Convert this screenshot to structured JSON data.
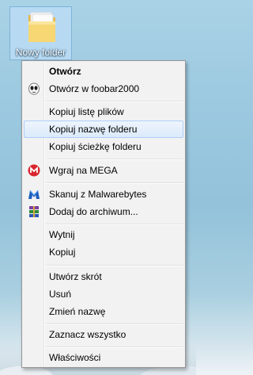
{
  "desktop": {
    "selected_item_label": "Nowy folder",
    "icon": "folder-icon"
  },
  "menu": {
    "items": [
      {
        "label": "Otwórz",
        "bold": true
      },
      {
        "label": "Otwórz w foobar2000",
        "icon": "foobar2000-icon"
      },
      {
        "label": "Kopiuj listę plików"
      },
      {
        "label": "Kopiuj nazwę folderu",
        "highlighted": true
      },
      {
        "label": "Kopiuj ścieżkę folderu"
      },
      {
        "label": "Wgraj na MEGA",
        "icon": "mega-icon"
      },
      {
        "label": "Skanuj z Malwarebytes",
        "icon": "malwarebytes-icon"
      },
      {
        "label": "Dodaj do archiwum...",
        "icon": "winrar-icon"
      },
      {
        "label": "Wytnij"
      },
      {
        "label": "Kopiuj"
      },
      {
        "label": "Utwórz skrót"
      },
      {
        "label": "Usuń"
      },
      {
        "label": "Zmień nazwę"
      },
      {
        "label": "Zaznacz wszystko"
      },
      {
        "label": "Właściwości"
      }
    ]
  },
  "colors": {
    "highlight_border": "#aecff7",
    "mega_red": "#d9272e",
    "malwarebytes_blue": "#1f5fbf"
  }
}
